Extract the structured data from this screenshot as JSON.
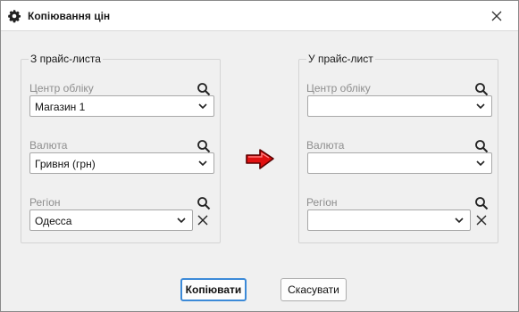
{
  "window": {
    "title": "Копіювання цін",
    "icon": "gear-icon",
    "close_icon": "close-icon"
  },
  "source": {
    "legend": "З прайс-листа",
    "center": {
      "label": "Центр обліку",
      "value": "Магазин 1"
    },
    "currency": {
      "label": "Валюта",
      "value": "Гривня (грн)"
    },
    "region": {
      "label": "Регіон",
      "value": "Одесса"
    }
  },
  "target": {
    "legend": "У прайс-лист",
    "center": {
      "label": "Центр обліку",
      "value": ""
    },
    "currency": {
      "label": "Валюта",
      "value": ""
    },
    "region": {
      "label": "Регіон",
      "value": ""
    }
  },
  "arrow_icon": "right-arrow-icon",
  "buttons": {
    "copy": "Копіювати",
    "cancel": "Скасувати"
  },
  "colors": {
    "arrow": "#e01010",
    "focus_border": "#3c8ad8"
  }
}
